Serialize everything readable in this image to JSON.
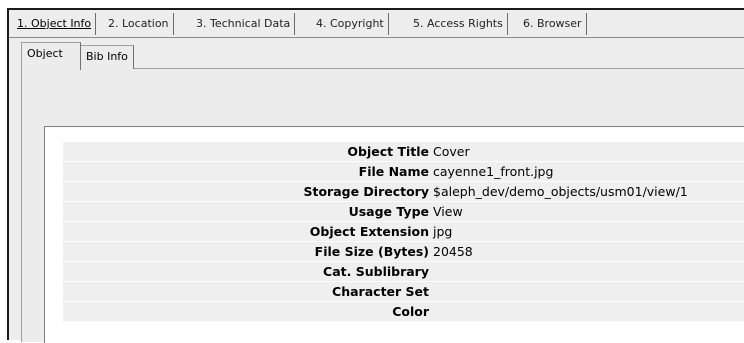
{
  "top_tabs": [
    {
      "label": "1. Object Info",
      "active": true
    },
    {
      "label": "2. Location",
      "active": false
    },
    {
      "label": "3. Technical Data",
      "active": false
    },
    {
      "label": "4. Copyright",
      "active": false
    },
    {
      "label": "5. Access Rights",
      "active": false
    },
    {
      "label": "6. Browser",
      "active": false
    }
  ],
  "sub_tabs": [
    {
      "label": "Object",
      "active": true
    },
    {
      "label": "Bib Info",
      "active": false
    }
  ],
  "fields": [
    {
      "label": "Object Title",
      "value": "Cover"
    },
    {
      "label": "File Name",
      "value": "cayenne1_front.jpg"
    },
    {
      "label": "Storage Directory",
      "value": "$aleph_dev/demo_objects/usm01/view/1"
    },
    {
      "label": "Usage Type",
      "value": "View"
    },
    {
      "label": "Object Extension",
      "value": "jpg"
    },
    {
      "label": "File Size (Bytes)",
      "value": "20458"
    },
    {
      "label": "Cat. Sublibrary",
      "value": ""
    },
    {
      "label": "Character Set",
      "value": ""
    },
    {
      "label": "Color",
      "value": ""
    }
  ],
  "colors": {
    "panel": "#ededed",
    "row": "#efefef",
    "content": "#ffffff",
    "border_dark": "#1a1a1a"
  }
}
